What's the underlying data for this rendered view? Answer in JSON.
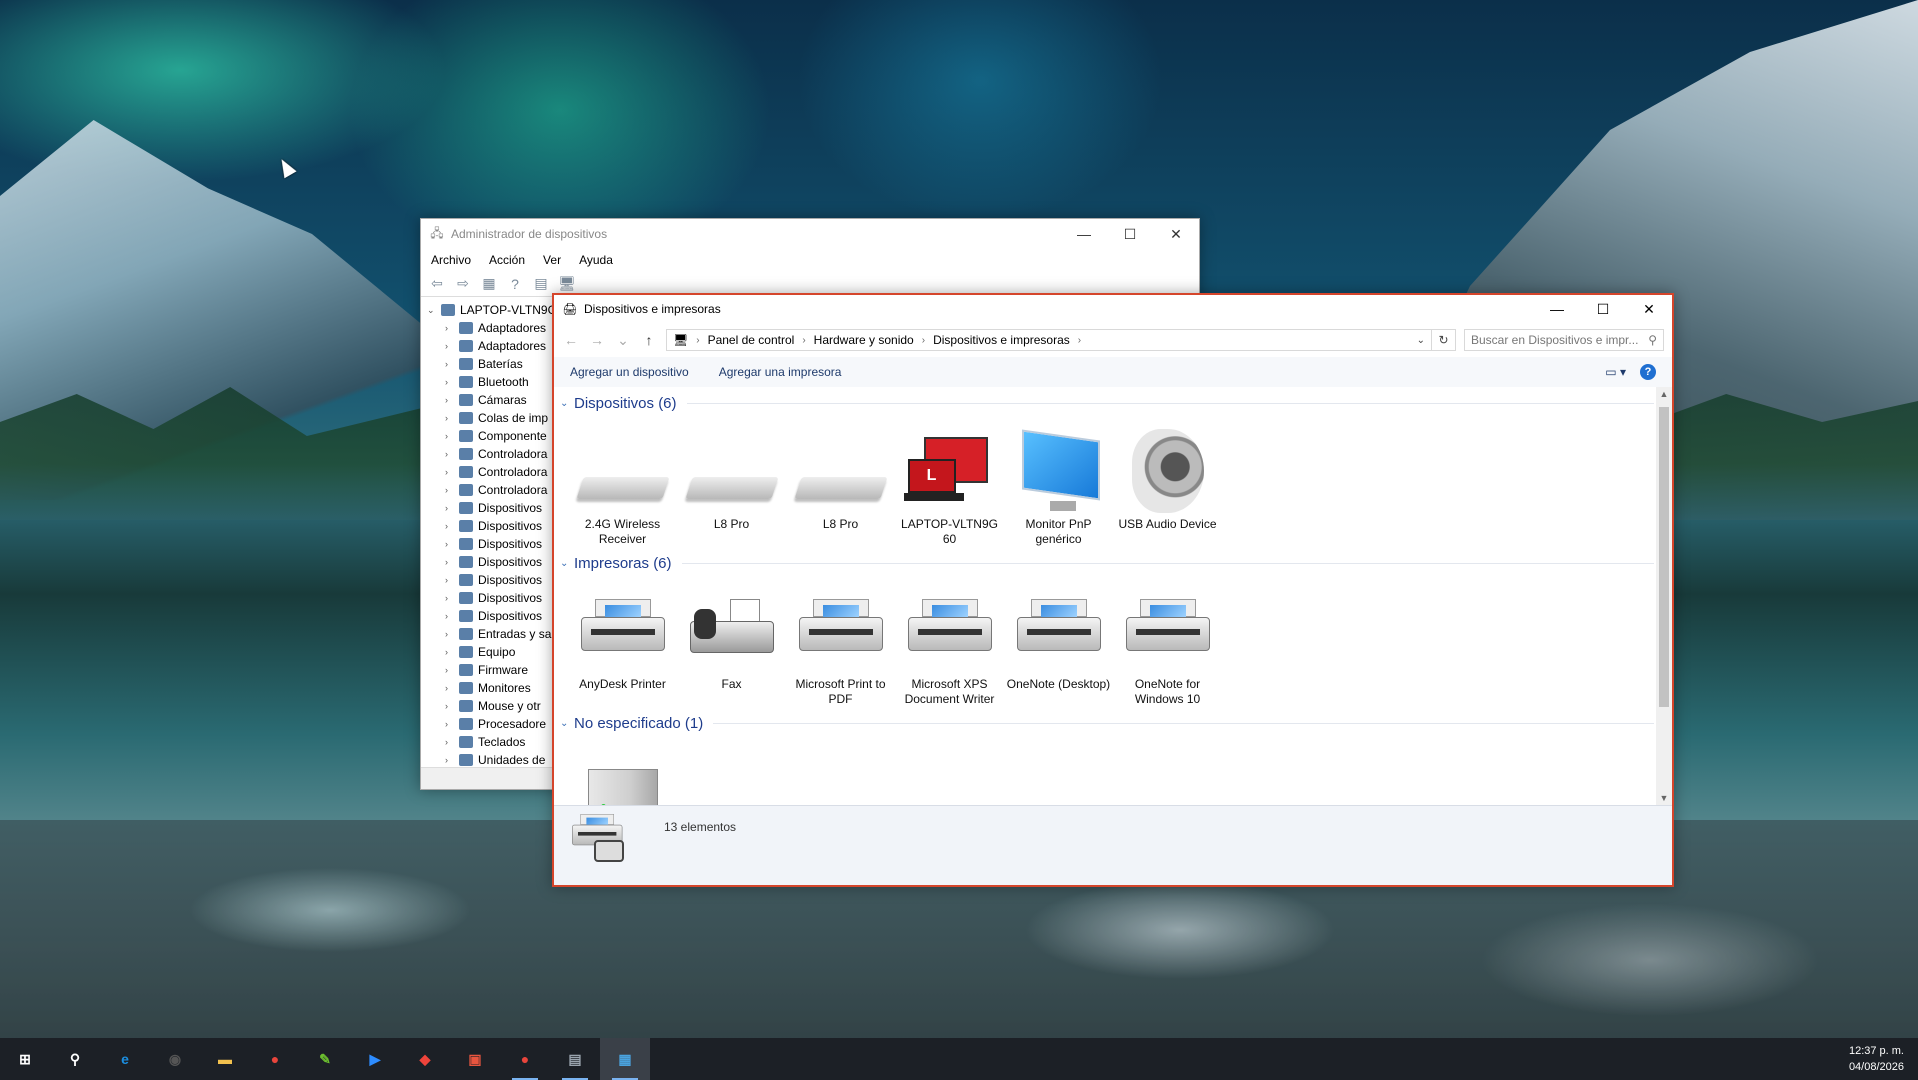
{
  "desktop": {},
  "device_manager": {
    "title": "Administrador de dispositivos",
    "menu": [
      "Archivo",
      "Acción",
      "Ver",
      "Ayuda"
    ],
    "root": "LAPTOP-VLTN9G",
    "nodes": [
      "Adaptadores",
      "Adaptadores",
      "Baterías",
      "Bluetooth",
      "Cámaras",
      "Colas de imp",
      "Componente",
      "Controladora",
      "Controladora",
      "Controladora",
      "Dispositivos",
      "Dispositivos",
      "Dispositivos",
      "Dispositivos",
      "Dispositivos",
      "Dispositivos",
      "Dispositivos",
      "Entradas y sa",
      "Equipo",
      "Firmware",
      "Monitores",
      "Mouse y otr",
      "Procesadore",
      "Teclados",
      "Unidades de"
    ]
  },
  "devices_printers": {
    "title": "Dispositivos e impresoras",
    "breadcrumb": [
      "Panel de control",
      "Hardware y sonido",
      "Dispositivos e impresoras"
    ],
    "search_placeholder": "Buscar en Dispositivos e impr...",
    "commands": [
      "Agregar un dispositivo",
      "Agregar una impresora"
    ],
    "groups": {
      "devices": {
        "header": "Dispositivos (6)",
        "items": [
          {
            "label": "2.4G Wireless Receiver",
            "icon": "keyboard-icon"
          },
          {
            "label": "L8 Pro",
            "icon": "keyboard-icon"
          },
          {
            "label": "L8 Pro",
            "icon": "keyboard-icon"
          },
          {
            "label": "LAPTOP-VLTN9G 60",
            "icon": "laptop-icon"
          },
          {
            "label": "Monitor PnP genérico",
            "icon": "monitor-icon"
          },
          {
            "label": "USB Audio Device",
            "icon": "speaker-icon"
          }
        ]
      },
      "printers": {
        "header": "Impresoras (6)",
        "items": [
          {
            "label": "AnyDesk Printer",
            "icon": "printer-icon"
          },
          {
            "label": "Fax",
            "icon": "fax-icon"
          },
          {
            "label": "Microsoft Print to PDF",
            "icon": "printer-icon"
          },
          {
            "label": "Microsoft XPS Document Writer",
            "icon": "printer-icon"
          },
          {
            "label": "OneNote (Desktop)",
            "icon": "printer-icon"
          },
          {
            "label": "OneNote for Windows 10",
            "icon": "printer-icon"
          }
        ]
      },
      "unspecified": {
        "header": "No especificado (1)"
      }
    },
    "status": "13 elementos"
  },
  "taskbar": {
    "time": "12:37 p. m.",
    "date": "04/08/2026",
    "apps": [
      {
        "name": "start-icon",
        "glyph": "⊞",
        "color": "#ffffff"
      },
      {
        "name": "search-icon",
        "glyph": "⚲",
        "color": "#ffffff"
      },
      {
        "name": "edge-icon",
        "glyph": "e",
        "color": "#1b8ee0"
      },
      {
        "name": "obs-icon",
        "glyph": "◉",
        "color": "#555555"
      },
      {
        "name": "file-explorer-icon",
        "glyph": "▬",
        "color": "#f2c14e"
      },
      {
        "name": "chrome-icon",
        "glyph": "●",
        "color": "#e8453c"
      },
      {
        "name": "script-icon",
        "glyph": "✎",
        "color": "#6cbf2f"
      },
      {
        "name": "zoom-icon",
        "glyph": "▶",
        "color": "#2d8cff"
      },
      {
        "name": "anydesk-icon",
        "glyph": "◆",
        "color": "#ef443b"
      },
      {
        "name": "toolbox-icon",
        "glyph": "▣",
        "color": "#e8553f"
      },
      {
        "name": "chrome-profile-icon",
        "glyph": "●",
        "color": "#e8453c"
      },
      {
        "name": "device-manager-icon",
        "glyph": "▤",
        "color": "#9aa4ae"
      },
      {
        "name": "devices-printers-icon",
        "glyph": "▦",
        "color": "#4aa3df"
      }
    ]
  }
}
